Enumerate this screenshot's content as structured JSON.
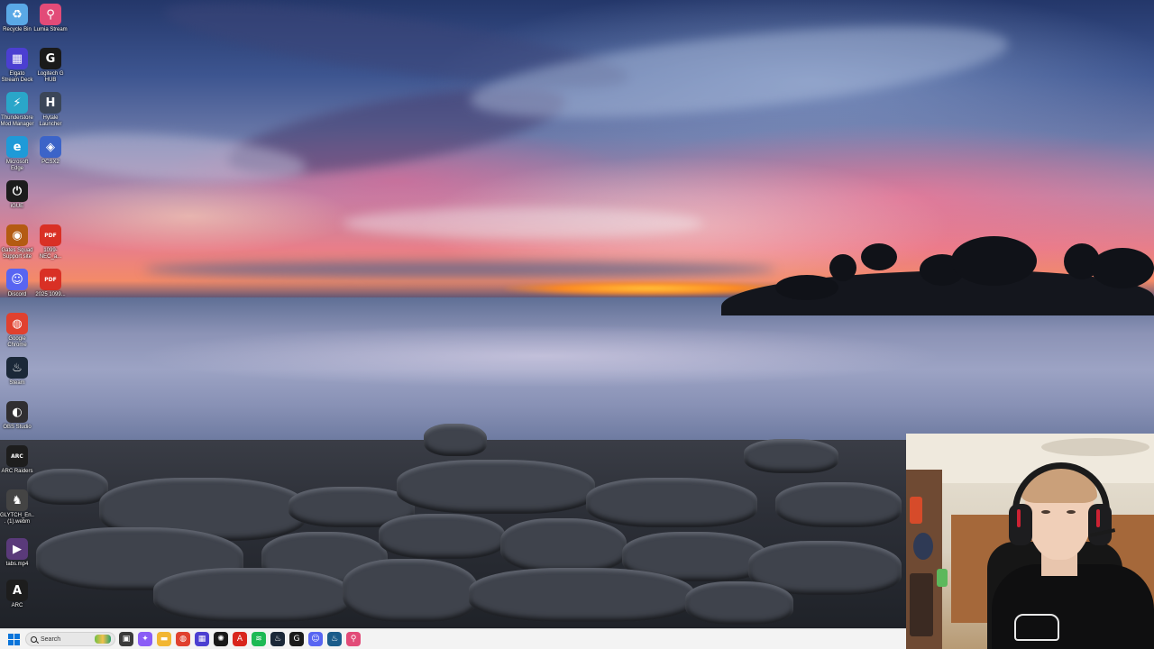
{
  "desktop": {
    "icons": [
      {
        "id": "recycle-bin",
        "label": "Recycle Bin",
        "icon": "recycle-bin-icon",
        "color": "#5aa8e6",
        "glyph": "♻"
      },
      {
        "id": "lumia-stream",
        "label": "Lumia Stream",
        "icon": "lumia-stream-icon",
        "color": "#e24b78",
        "glyph": "⚲"
      },
      {
        "id": "elgato-stream-deck",
        "label": "Elgato Stream Deck",
        "icon": "stream-deck-icon",
        "color": "#4b3fd1",
        "glyph": "▦"
      },
      {
        "id": "logitech-g-hub",
        "label": "Logitech G HUB",
        "icon": "logitech-g-icon",
        "color": "#1a1a1a",
        "glyph": "G"
      },
      {
        "id": "thunderstore-mod-manager",
        "label": "Thunderstore Mod Manager",
        "icon": "thunderstore-icon",
        "color": "#2aa6c9",
        "glyph": "⚡"
      },
      {
        "id": "hytale-launcher",
        "label": "Hytale Launcher",
        "icon": "hytale-icon",
        "color": "#3b4658",
        "glyph": "H"
      },
      {
        "id": "microsoft-edge",
        "label": "Microsoft Edge",
        "icon": "edge-icon",
        "color": "#1f9ad8",
        "glyph": "e"
      },
      {
        "id": "pcsx2",
        "label": "PCSX2",
        "icon": "pcsx2-icon",
        "color": "#3c64c8",
        "glyph": "◈"
      },
      {
        "id": "igue",
        "label": "iGUE",
        "icon": "power-icon",
        "color": "#1c1c1c",
        "glyph": "⏻"
      },
      {
        "id": "gates-squad-support-site",
        "label": "Gates Squad Support site",
        "icon": "gates-squad-icon",
        "color": "#b45b12",
        "glyph": "◉"
      },
      {
        "id": "pdf-1099-nec",
        "label": "1099-NEC_a...",
        "icon": "pdf-icon",
        "color": "#d93025",
        "glyph": "PDF"
      },
      {
        "id": "discord",
        "label": "Discord",
        "icon": "discord-icon",
        "color": "#5865f2",
        "glyph": "☺"
      },
      {
        "id": "pdf-2025",
        "label": "2025 1099...",
        "icon": "pdf-icon",
        "color": "#d93025",
        "glyph": "PDF"
      },
      {
        "id": "google-chrome",
        "label": "Google Chrome",
        "icon": "chrome-icon",
        "color": "#e0412f",
        "glyph": "◍"
      },
      {
        "id": "steam",
        "label": "Steam",
        "icon": "steam-icon",
        "color": "#1b2838",
        "glyph": "♨"
      },
      {
        "id": "obs-studio",
        "label": "OBS Studio",
        "icon": "obs-icon",
        "color": "#302e31",
        "glyph": "◐"
      },
      {
        "id": "arc-raiders",
        "label": "ARC Raiders",
        "icon": "arc-raiders-icon",
        "color": "#1d1d1d",
        "glyph": "ARC"
      },
      {
        "id": "glitch-webm",
        "label": "GLYTCH_En... (1).webm",
        "icon": "video-file-icon",
        "color": "#444444",
        "glyph": "♞"
      },
      {
        "id": "tabs-mp4",
        "label": "tabs.mp4",
        "icon": "video-file-icon",
        "color": "#5a3a7a",
        "glyph": "▶"
      },
      {
        "id": "arc",
        "label": "ARC",
        "icon": "arc-icon",
        "color": "#1d1d1d",
        "glyph": "A"
      }
    ]
  },
  "taskbar": {
    "search_placeholder": "Search",
    "start_icon": "windows-start-icon",
    "apps": [
      {
        "id": "file-explorer-small",
        "icon": "task-view-icon",
        "color": "#3a3a3a",
        "glyph": "▣"
      },
      {
        "id": "copilot",
        "icon": "copilot-icon",
        "color": "#8a5cf6",
        "glyph": "✦"
      },
      {
        "id": "file-explorer",
        "icon": "folder-icon",
        "color": "#f2b632",
        "glyph": "▬"
      },
      {
        "id": "chrome",
        "icon": "chrome-icon",
        "color": "#e0412f",
        "glyph": "◍"
      },
      {
        "id": "stream-deck",
        "icon": "stream-deck-icon",
        "color": "#4b3fd1",
        "glyph": "▦"
      },
      {
        "id": "razer",
        "icon": "razer-icon",
        "color": "#1a1a1a",
        "glyph": "✺"
      },
      {
        "id": "adobe",
        "icon": "adobe-icon",
        "color": "#d9251c",
        "glyph": "A"
      },
      {
        "id": "spotify",
        "icon": "spotify-icon",
        "color": "#1db954",
        "glyph": "≋"
      },
      {
        "id": "steam",
        "icon": "steam-icon",
        "color": "#1b2838",
        "glyph": "♨"
      },
      {
        "id": "logitech",
        "icon": "logitech-g-icon",
        "color": "#1a1a1a",
        "glyph": "G"
      },
      {
        "id": "discord",
        "icon": "discord-icon",
        "color": "#5865f2",
        "glyph": "☺"
      },
      {
        "id": "steam-2",
        "icon": "steam-icon",
        "color": "#1b5c8a",
        "glyph": "♨"
      },
      {
        "id": "lumia",
        "icon": "lumia-stream-icon",
        "color": "#e24b78",
        "glyph": "⚲"
      }
    ]
  }
}
